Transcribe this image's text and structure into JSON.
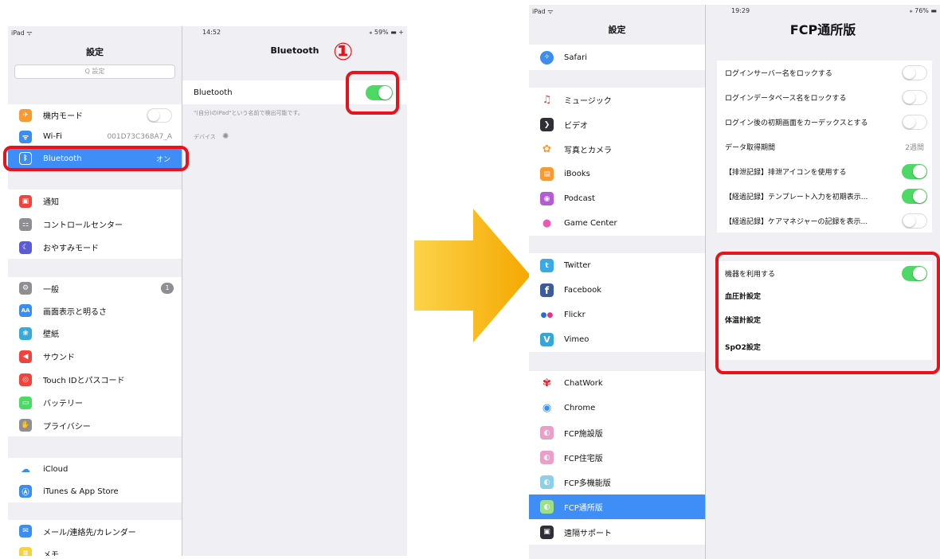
{
  "colors": {
    "highlight": "#3f8ef7",
    "toggle_on": "#4cd964",
    "annotation_red": "#e8121b",
    "arrow_orange": "#f7b52c"
  },
  "left": {
    "status": {
      "device": "iPad ᯤ",
      "time": "14:52",
      "battery": "⁎ 59% ▬ +"
    },
    "master_title": "設定",
    "search_placeholder": "Q 設定",
    "detail_title": "Bluetooth",
    "annotation_number": "①",
    "menu": {
      "airplane": {
        "label": "機内モード",
        "icon": "airplane-icon",
        "color": "#f79a33"
      },
      "wifi": {
        "label": "Wi-Fi",
        "value": "001D73C368A7_A",
        "icon": "wifi-icon",
        "color": "#3b8ef0"
      },
      "bluetooth": {
        "label": "Bluetooth",
        "value": "オン",
        "icon": "bluetooth-icon",
        "color": "#3b8ef0"
      },
      "notifications": {
        "label": "通知",
        "icon": "notification-icon",
        "color": "#f2423c"
      },
      "control_center": {
        "label": "コントロールセンター",
        "icon": "control-center-icon",
        "color": "#8e8e93"
      },
      "do_not_disturb": {
        "label": "おやすみモード",
        "icon": "moon-icon",
        "color": "#5b5bd6"
      },
      "general": {
        "label": "一般",
        "badge": "1",
        "icon": "gear-icon",
        "color": "#8e8e93"
      },
      "display": {
        "label": "画面表示と明るさ",
        "icon": "display-icon",
        "color": "#3b8ef0"
      },
      "wallpaper": {
        "label": "壁紙",
        "icon": "wallpaper-icon",
        "color": "#35aadc"
      },
      "sounds": {
        "label": "サウンド",
        "icon": "speaker-icon",
        "color": "#f2423c"
      },
      "touch_id": {
        "label": "Touch IDとパスコード",
        "icon": "fingerprint-icon",
        "color": "#f2423c"
      },
      "battery": {
        "label": "バッテリー",
        "icon": "battery-icon",
        "color": "#4cd964"
      },
      "privacy": {
        "label": "プライバシー",
        "icon": "hand-icon",
        "color": "#8e8e93"
      },
      "icloud": {
        "label": "iCloud",
        "icon": "cloud-icon",
        "color": "#ffffff"
      },
      "itunes": {
        "label": "iTunes & App Store",
        "icon": "app-store-icon",
        "color": "#3b8ef0"
      },
      "mail": {
        "label": "メール/連絡先/カレンダー",
        "icon": "mail-icon",
        "color": "#3b8ef0"
      },
      "notes": {
        "label": "メモ",
        "icon": "notes-icon",
        "color": "#f7d23b"
      }
    },
    "detail": {
      "bluetooth_label": "Bluetooth",
      "bluetooth_on": true,
      "discoverable_note": "\"(自分)のiPad\"という名前で検出可能です。",
      "devices_header": "デバイス"
    }
  },
  "right": {
    "status": {
      "device": "iPad ᯤ",
      "time": "19:29",
      "battery": "⁎ 76% ▬"
    },
    "master_title": "設定",
    "detail_title": "FCP通所版",
    "menu": {
      "safari": {
        "label": "Safari",
        "icon": "safari-icon",
        "color": "#3b8ef0"
      },
      "music": {
        "label": "ミュージック",
        "icon": "music-icon",
        "color": "#ffffff"
      },
      "videos": {
        "label": "ビデオ",
        "icon": "video-icon",
        "color": "#2f2f35"
      },
      "photos": {
        "label": "写真とカメラ",
        "icon": "photos-icon",
        "color": "#ffffff"
      },
      "ibooks": {
        "label": "iBooks",
        "icon": "book-icon",
        "color": "#f79a33"
      },
      "podcast": {
        "label": "Podcast",
        "icon": "podcast-icon",
        "color": "#b45bd6"
      },
      "game_center": {
        "label": "Game Center",
        "icon": "game-center-icon",
        "color": "#ffffff"
      },
      "twitter": {
        "label": "Twitter",
        "icon": "twitter-icon",
        "color": "#3aa9e6"
      },
      "facebook": {
        "label": "Facebook",
        "icon": "facebook-icon",
        "color": "#3b5b9a"
      },
      "flickr": {
        "label": "Flickr",
        "icon": "flickr-icon",
        "color": "#ffffff"
      },
      "vimeo": {
        "label": "Vimeo",
        "icon": "vimeo-icon",
        "color": "#35a6d6"
      },
      "chatwork": {
        "label": "ChatWork",
        "icon": "chatwork-icon",
        "color": "#ffffff"
      },
      "chrome": {
        "label": "Chrome",
        "icon": "chrome-icon",
        "color": "#ffffff"
      },
      "fcp_facility": {
        "label": "FCP施設版",
        "icon": "fcp-icon",
        "color": "#e8a0c8"
      },
      "fcp_home": {
        "label": "FCP住宅版",
        "icon": "fcp-icon",
        "color": "#e8a0c8"
      },
      "fcp_multi": {
        "label": "FCP多機能版",
        "icon": "fcp-icon",
        "color": "#8ecfe8"
      },
      "fcp_daycare": {
        "label": "FCP通所版",
        "icon": "fcp-icon",
        "color": "#9ee08a"
      },
      "remote_support": {
        "label": "遠隔サポート",
        "icon": "remote-support-icon",
        "color": "#2f2f35"
      }
    },
    "settings": {
      "lock_server": {
        "label": "ログインサーバー名をロックする",
        "on": false
      },
      "lock_database": {
        "label": "ログインデータベース名をロックする",
        "on": false
      },
      "initial_cardex": {
        "label": "ログイン後の初期画面をカーデックスとする",
        "on": false
      },
      "data_period": {
        "label": "データ取得期間",
        "value": "2週間"
      },
      "excretion_icon": {
        "label": "【排泄記録】排泄アイコンを使用する",
        "on": true
      },
      "template_input": {
        "label": "【経過記録】テンプレート入力を初期表示...",
        "on": true
      },
      "care_manager": {
        "label": "【経過記録】ケアマネジャーの記録を表示...",
        "on": false
      }
    },
    "device_group": {
      "use_devices": {
        "label": "機器を利用する",
        "on": true
      },
      "bp_settings": {
        "label": "血圧計設定"
      },
      "thermo_settings": {
        "label": "体温計設定"
      },
      "spo2_settings": {
        "label": "SpO2設定"
      }
    }
  }
}
